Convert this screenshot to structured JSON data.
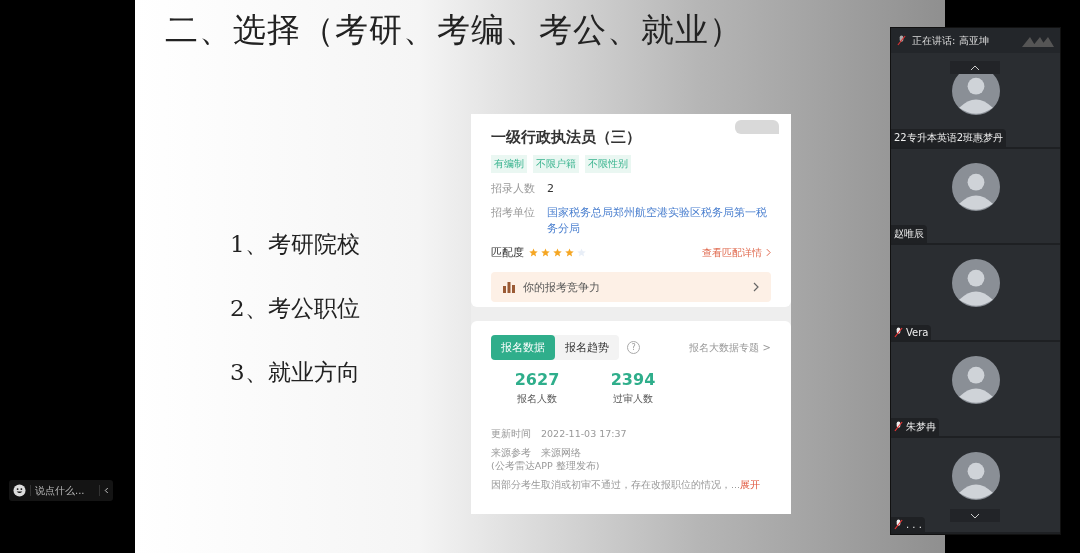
{
  "slide": {
    "title": "二、选择（考研、考编、考公、就业）",
    "items": [
      "1、考研院校",
      "2、考公职位",
      "3、就业方向"
    ],
    "card": {
      "job_title": "一级行政执法员（三）",
      "tags": [
        "有编制",
        "不限户籍",
        "不限性别"
      ],
      "fields": [
        {
          "label": "招录人数",
          "value": "2",
          "kind": "plain"
        },
        {
          "label": "招考单位",
          "value": "国家税务总局郑州航空港实验区税务局第一税务分局",
          "kind": "link"
        }
      ],
      "match": {
        "label": "匹配度",
        "stars": 4,
        "link": "查看匹配详情"
      },
      "competition": "你的报考竞争力",
      "tabs": [
        {
          "label": "报名数据",
          "selected": true
        },
        {
          "label": "报名趋势",
          "selected": false
        }
      ],
      "help": "?",
      "topic_link": "报名大数据专题 >",
      "stats": [
        {
          "value": "2627",
          "label": "报名人数"
        },
        {
          "value": "2394",
          "label": "过审人数"
        }
      ],
      "update": {
        "label": "更新时间",
        "value": "2022-11-03 17:37"
      },
      "source": {
        "label": "来源参考",
        "value": "来源网络",
        "note": "(公考雷达APP 整理发布)"
      },
      "notice": "因部分考生取消或初审不通过，存在改报职位的情况，...",
      "expand": "展开"
    }
  },
  "chat": {
    "placeholder": "说点什么..."
  },
  "panel": {
    "speaking": "正在讲话: 高亚坤",
    "participants": [
      {
        "name": "22专升本英语2班惠梦丹",
        "muted": false
      },
      {
        "name": "赵唯辰",
        "muted": false
      },
      {
        "name": "Vera",
        "muted": true
      },
      {
        "name": "朱梦冉",
        "muted": true
      },
      {
        "name": ". . .",
        "muted": true
      }
    ]
  }
}
